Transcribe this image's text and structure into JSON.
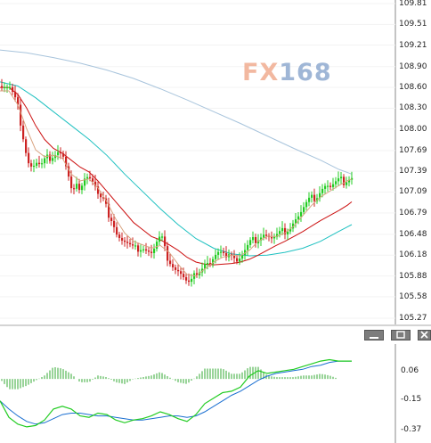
{
  "watermark": {
    "brand_prefix": "FX",
    "brand_number": "168"
  },
  "colors": {
    "up_candle": "#22cc22",
    "down_candle": "#cc2222",
    "ma_fast": "#d9a380",
    "ma_mid": "#cc1111",
    "ma_slow": "#1fc1c1",
    "ma_long": "#a8c4dc",
    "macd_line": "#22cc22",
    "signal_line": "#1a6fd1",
    "histogram": "#33aa33"
  },
  "window_controls": [
    "minimize-icon",
    "restore-icon",
    "close-icon"
  ],
  "chart_data": [
    {
      "type": "candlestick",
      "ylim": [
        105.27,
        109.81
      ],
      "y_ticks": [
        "109.81",
        "109.51",
        "109.21",
        "108.90",
        "108.60",
        "108.30",
        "108.00",
        "107.69",
        "107.39",
        "107.09",
        "106.79",
        "106.48",
        "106.18",
        "105.88",
        "105.58",
        "105.27"
      ],
      "close_path": [
        [
          0,
          108.62
        ],
        [
          5,
          108.6
        ],
        [
          10,
          108.58
        ],
        [
          15,
          108.45
        ],
        [
          20,
          108.25
        ],
        [
          25,
          107.9
        ],
        [
          30,
          107.55
        ],
        [
          35,
          107.45
        ],
        [
          40,
          107.5
        ],
        [
          45,
          107.45
        ],
        [
          50,
          107.55
        ],
        [
          55,
          107.6
        ],
        [
          60,
          107.65
        ],
        [
          65,
          107.7
        ],
        [
          70,
          107.6
        ],
        [
          75,
          107.35
        ],
        [
          80,
          107.05
        ],
        [
          85,
          107.15
        ],
        [
          90,
          107.2
        ],
        [
          95,
          107.35
        ],
        [
          100,
          107.3
        ],
        [
          105,
          107.2
        ],
        [
          110,
          107.0
        ],
        [
          115,
          106.95
        ],
        [
          120,
          106.8
        ],
        [
          125,
          106.7
        ],
        [
          130,
          106.5
        ],
        [
          135,
          106.4
        ],
        [
          140,
          106.35
        ],
        [
          145,
          106.3
        ],
        [
          150,
          106.25
        ],
        [
          155,
          106.3
        ],
        [
          160,
          106.3
        ],
        [
          165,
          106.25
        ],
        [
          170,
          106.2
        ],
        [
          175,
          106.35
        ],
        [
          180,
          106.45
        ],
        [
          185,
          106.2
        ],
        [
          190,
          106.1
        ],
        [
          195,
          106.0
        ],
        [
          200,
          105.95
        ],
        [
          205,
          105.85
        ],
        [
          210,
          105.75
        ],
        [
          215,
          105.8
        ],
        [
          220,
          105.95
        ],
        [
          225,
          106.0
        ],
        [
          230,
          106.1
        ],
        [
          235,
          106.05
        ],
        [
          240,
          106.15
        ],
        [
          245,
          106.2
        ],
        [
          250,
          106.15
        ],
        [
          255,
          106.25
        ],
        [
          260,
          106.2
        ],
        [
          265,
          106.1
        ],
        [
          270,
          106.15
        ],
        [
          275,
          106.25
        ],
        [
          280,
          106.35
        ],
        [
          285,
          106.4
        ],
        [
          290,
          106.45
        ],
        [
          295,
          106.5
        ],
        [
          300,
          106.45
        ],
        [
          305,
          106.4
        ],
        [
          310,
          106.45
        ],
        [
          315,
          106.5
        ],
        [
          320,
          106.55
        ],
        [
          325,
          106.6
        ],
        [
          330,
          106.7
        ],
        [
          335,
          106.75
        ],
        [
          340,
          106.85
        ],
        [
          345,
          106.95
        ],
        [
          350,
          107.0
        ],
        [
          355,
          107.05
        ],
        [
          360,
          107.15
        ],
        [
          365,
          107.2
        ],
        [
          370,
          107.15
        ],
        [
          375,
          107.2
        ],
        [
          380,
          107.25
        ],
        [
          385,
          107.25
        ],
        [
          390,
          107.3
        ],
        [
          395,
          107.32
        ]
      ],
      "ma_fast": [
        [
          0,
          108.55
        ],
        [
          10,
          108.55
        ],
        [
          20,
          108.35
        ],
        [
          30,
          108.0
        ],
        [
          40,
          107.7
        ],
        [
          50,
          107.6
        ],
        [
          60,
          107.62
        ],
        [
          70,
          107.58
        ],
        [
          80,
          107.35
        ],
        [
          90,
          107.25
        ],
        [
          100,
          107.28
        ],
        [
          110,
          107.15
        ],
        [
          120,
          106.95
        ],
        [
          130,
          106.7
        ],
        [
          140,
          106.5
        ],
        [
          150,
          106.38
        ],
        [
          160,
          106.33
        ],
        [
          170,
          106.28
        ],
        [
          180,
          106.32
        ],
        [
          190,
          106.22
        ],
        [
          200,
          106.05
        ],
        [
          210,
          105.9
        ],
        [
          220,
          105.88
        ],
        [
          230,
          105.98
        ],
        [
          240,
          106.08
        ],
        [
          250,
          106.15
        ],
        [
          260,
          106.18
        ],
        [
          270,
          106.17
        ],
        [
          280,
          106.25
        ],
        [
          290,
          106.38
        ],
        [
          300,
          106.45
        ],
        [
          310,
          106.45
        ],
        [
          320,
          106.5
        ],
        [
          330,
          106.6
        ],
        [
          340,
          106.75
        ],
        [
          350,
          106.9
        ],
        [
          360,
          107.02
        ],
        [
          370,
          107.1
        ],
        [
          380,
          107.18
        ],
        [
          390,
          107.25
        ],
        [
          395,
          107.28
        ]
      ],
      "ma_mid": [
        [
          0,
          108.6
        ],
        [
          10,
          108.6
        ],
        [
          20,
          108.5
        ],
        [
          30,
          108.3
        ],
        [
          40,
          108.05
        ],
        [
          50,
          107.85
        ],
        [
          60,
          107.72
        ],
        [
          70,
          107.65
        ],
        [
          80,
          107.55
        ],
        [
          90,
          107.45
        ],
        [
          100,
          107.38
        ],
        [
          110,
          107.25
        ],
        [
          120,
          107.1
        ],
        [
          130,
          106.95
        ],
        [
          140,
          106.8
        ],
        [
          150,
          106.65
        ],
        [
          160,
          106.55
        ],
        [
          170,
          106.45
        ],
        [
          180,
          106.4
        ],
        [
          190,
          106.33
        ],
        [
          200,
          106.25
        ],
        [
          210,
          106.15
        ],
        [
          220,
          106.08
        ],
        [
          230,
          106.05
        ],
        [
          240,
          106.04
        ],
        [
          250,
          106.05
        ],
        [
          260,
          106.06
        ],
        [
          270,
          106.08
        ],
        [
          280,
          106.12
        ],
        [
          290,
          106.18
        ],
        [
          300,
          106.25
        ],
        [
          310,
          106.32
        ],
        [
          320,
          106.38
        ],
        [
          330,
          106.45
        ],
        [
          340,
          106.52
        ],
        [
          350,
          106.6
        ],
        [
          360,
          106.68
        ],
        [
          370,
          106.75
        ],
        [
          380,
          106.82
        ],
        [
          390,
          106.9
        ],
        [
          395,
          106.95
        ]
      ],
      "ma_slow": [
        [
          0,
          108.68
        ],
        [
          20,
          108.62
        ],
        [
          40,
          108.45
        ],
        [
          60,
          108.25
        ],
        [
          80,
          108.05
        ],
        [
          100,
          107.85
        ],
        [
          120,
          107.62
        ],
        [
          140,
          107.35
        ],
        [
          160,
          107.1
        ],
        [
          180,
          106.85
        ],
        [
          200,
          106.62
        ],
        [
          220,
          106.42
        ],
        [
          240,
          106.28
        ],
        [
          260,
          106.2
        ],
        [
          280,
          106.17
        ],
        [
          300,
          106.18
        ],
        [
          320,
          106.22
        ],
        [
          340,
          106.28
        ],
        [
          360,
          106.38
        ],
        [
          380,
          106.52
        ],
        [
          395,
          106.62
        ]
      ],
      "ma_long": [
        [
          0,
          109.14
        ],
        [
          30,
          109.1
        ],
        [
          60,
          109.03
        ],
        [
          90,
          108.95
        ],
        [
          120,
          108.85
        ],
        [
          150,
          108.73
        ],
        [
          180,
          108.58
        ],
        [
          210,
          108.42
        ],
        [
          240,
          108.25
        ],
        [
          270,
          108.08
        ],
        [
          300,
          107.9
        ],
        [
          330,
          107.72
        ],
        [
          360,
          107.55
        ],
        [
          380,
          107.42
        ],
        [
          395,
          107.35
        ]
      ]
    },
    {
      "type": "line",
      "ylim": [
        -0.37,
        0.15
      ],
      "y_ticks": [
        "0.06",
        "-0.15",
        "-0.37"
      ],
      "macd": [
        [
          0,
          -0.16
        ],
        [
          10,
          -0.28
        ],
        [
          20,
          -0.33
        ],
        [
          30,
          -0.35
        ],
        [
          40,
          -0.34
        ],
        [
          50,
          -0.3
        ],
        [
          60,
          -0.22
        ],
        [
          70,
          -0.2
        ],
        [
          80,
          -0.22
        ],
        [
          90,
          -0.27
        ],
        [
          100,
          -0.28
        ],
        [
          110,
          -0.25
        ],
        [
          120,
          -0.26
        ],
        [
          130,
          -0.3
        ],
        [
          140,
          -0.32
        ],
        [
          150,
          -0.3
        ],
        [
          160,
          -0.29
        ],
        [
          170,
          -0.27
        ],
        [
          180,
          -0.24
        ],
        [
          190,
          -0.26
        ],
        [
          200,
          -0.29
        ],
        [
          210,
          -0.31
        ],
        [
          220,
          -0.26
        ],
        [
          230,
          -0.18
        ],
        [
          240,
          -0.14
        ],
        [
          250,
          -0.1
        ],
        [
          260,
          -0.09
        ],
        [
          270,
          -0.06
        ],
        [
          280,
          0.02
        ],
        [
          290,
          0.06
        ],
        [
          300,
          0.04
        ],
        [
          310,
          0.05
        ],
        [
          320,
          0.06
        ],
        [
          330,
          0.07
        ],
        [
          340,
          0.09
        ],
        [
          350,
          0.11
        ],
        [
          360,
          0.13
        ],
        [
          370,
          0.14
        ],
        [
          380,
          0.13
        ],
        [
          390,
          0.13
        ],
        [
          395,
          0.13
        ]
      ],
      "signal": [
        [
          0,
          -0.16
        ],
        [
          10,
          -0.22
        ],
        [
          20,
          -0.27
        ],
        [
          30,
          -0.31
        ],
        [
          40,
          -0.33
        ],
        [
          50,
          -0.32
        ],
        [
          60,
          -0.29
        ],
        [
          70,
          -0.26
        ],
        [
          80,
          -0.25
        ],
        [
          90,
          -0.25
        ],
        [
          100,
          -0.26
        ],
        [
          110,
          -0.27
        ],
        [
          120,
          -0.27
        ],
        [
          130,
          -0.28
        ],
        [
          140,
          -0.29
        ],
        [
          150,
          -0.3
        ],
        [
          160,
          -0.3
        ],
        [
          170,
          -0.29
        ],
        [
          180,
          -0.28
        ],
        [
          190,
          -0.27
        ],
        [
          200,
          -0.27
        ],
        [
          210,
          -0.28
        ],
        [
          220,
          -0.27
        ],
        [
          230,
          -0.24
        ],
        [
          240,
          -0.2
        ],
        [
          250,
          -0.16
        ],
        [
          260,
          -0.12
        ],
        [
          270,
          -0.09
        ],
        [
          280,
          -0.05
        ],
        [
          290,
          -0.01
        ],
        [
          300,
          0.02
        ],
        [
          310,
          0.04
        ],
        [
          320,
          0.05
        ],
        [
          330,
          0.06
        ],
        [
          340,
          0.07
        ],
        [
          350,
          0.09
        ],
        [
          360,
          0.1
        ],
        [
          370,
          0.12
        ],
        [
          380,
          0.13
        ],
        [
          390,
          0.13
        ],
        [
          395,
          0.13
        ]
      ]
    }
  ]
}
